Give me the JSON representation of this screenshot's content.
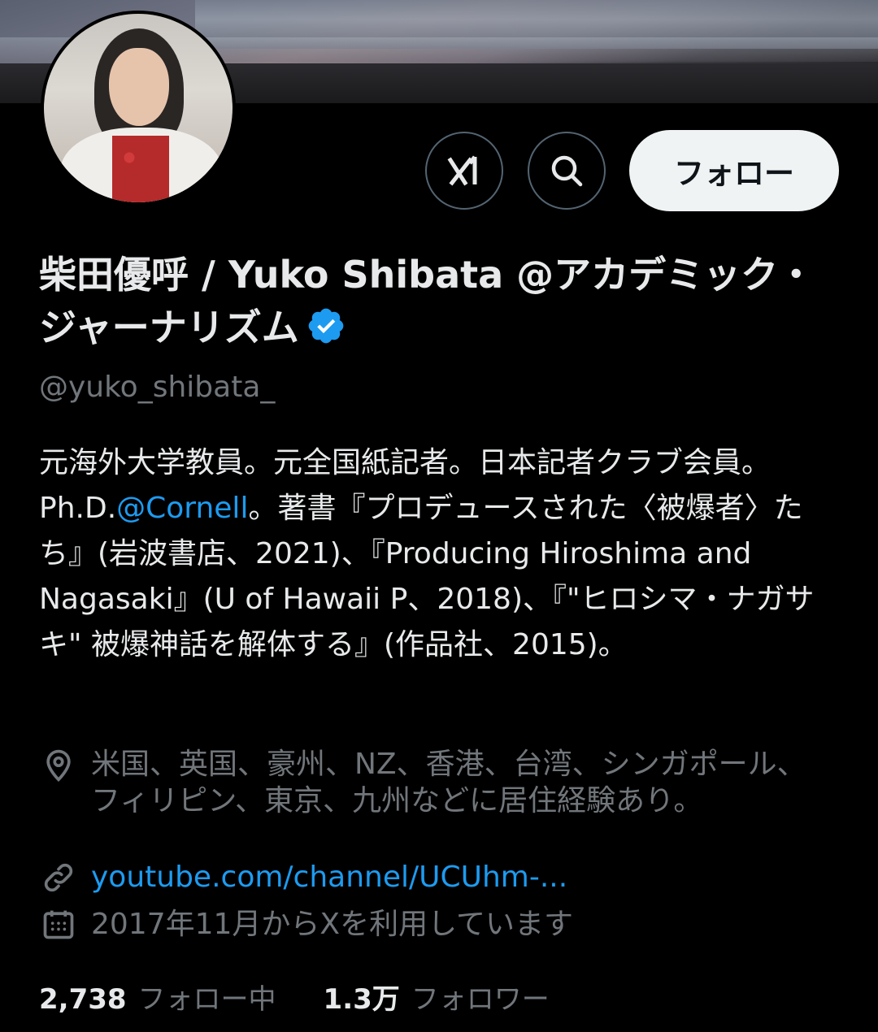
{
  "profile": {
    "display_name": "柴田優呼 / Yuko Shibata @アカデミック・ジャーナリズム",
    "handle": "@yuko_shibata_",
    "verified": true,
    "bio": {
      "part1": "元海外大学教員。元全国紙記者。日本記者クラブ会員。Ph.D.",
      "mention": "@Cornell",
      "part2": "。著書『プロデュースされた〈被爆者〉たち』(岩波書店、2021)、『Producing Hiroshima and Nagasaki』(U of Hawaii P、2018)、『\"ヒロシマ・ナガサキ\" 被爆神話を解体する』(作品社、2015)。"
    },
    "location": "米国、英国、豪州、NZ、香港、台湾、シンガポール、フィリピン、東京、九州などに居住経験あり。",
    "website": "youtube.com/channel/UCUhm-...",
    "joined": "2017年11月からXを利用しています",
    "stats": {
      "following_count": "2,738",
      "following_label": "フォロー中",
      "followers_count": "1.3万",
      "followers_label": "フォロワー"
    }
  },
  "actions": {
    "grok_icon": "grok-icon",
    "search_icon": "search-icon",
    "follow_label": "フォロー"
  },
  "colors": {
    "background": "#000000",
    "text_primary": "#e7e9ea",
    "text_secondary": "#71767b",
    "link": "#1d9bf0",
    "verified_badge": "#1d9bf0",
    "follow_button_bg": "#eff3f4"
  }
}
